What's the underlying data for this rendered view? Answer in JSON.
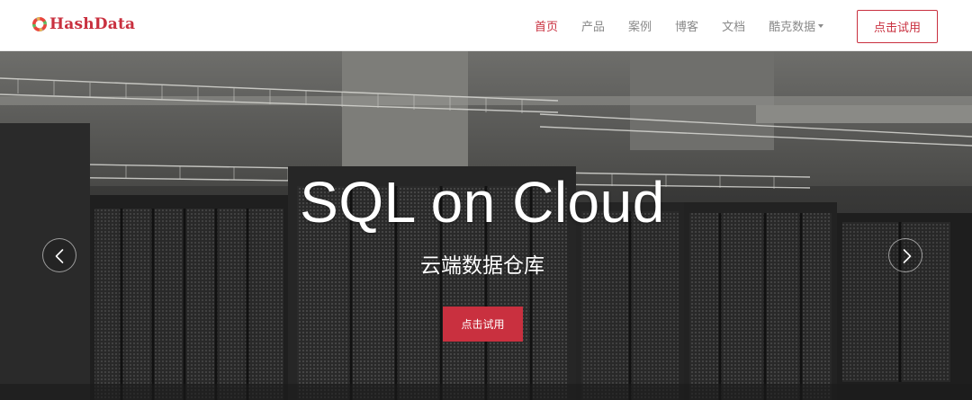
{
  "header": {
    "brand": "HashData",
    "nav": [
      {
        "label": "首页",
        "active": true
      },
      {
        "label": "产品",
        "active": false
      },
      {
        "label": "案例",
        "active": false
      },
      {
        "label": "博客",
        "active": false
      },
      {
        "label": "文档",
        "active": false
      }
    ],
    "dropdown_label": "酷克数据",
    "trial_button": "点击试用"
  },
  "hero": {
    "title": "SQL on Cloud",
    "subtitle": "云端数据仓库",
    "cta": "点击试用"
  },
  "colors": {
    "brand_red": "#c9303f",
    "nav_text": "#8a8a8a",
    "header_bg": "#ffffff"
  },
  "icons": {
    "logo": "hashdata-logo-ring-icon",
    "prev": "chevron-left-icon",
    "next": "chevron-right-icon",
    "dropdown": "caret-down-icon"
  }
}
